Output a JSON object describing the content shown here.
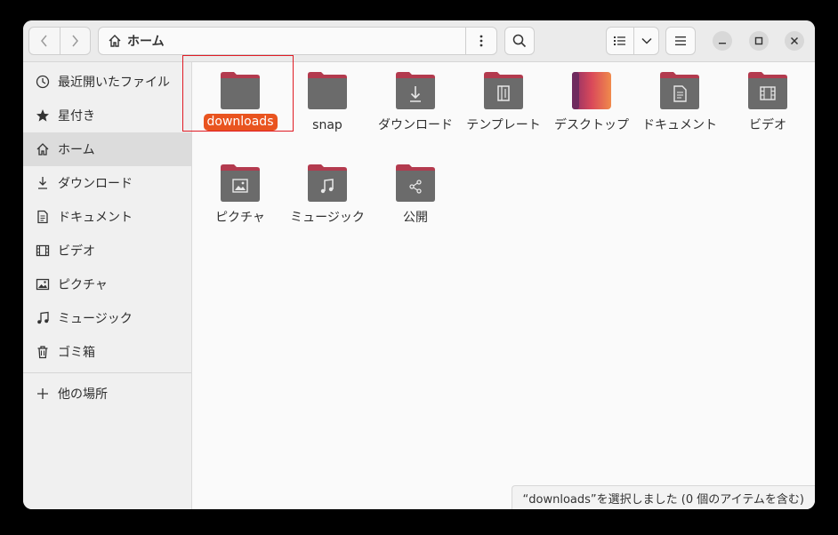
{
  "window": {
    "location_label": "ホーム",
    "status_text": "“downloads”を選択しました (0 個のアイテムを含む)"
  },
  "colors": {
    "accent": "#e9541f",
    "folder_tab": "#b33a4e",
    "folder_body": "#6b6b6b",
    "highlight_box": "#e01b24"
  },
  "sidebar": {
    "items": [
      {
        "label": "最近開いたファイル",
        "icon": "clock-icon"
      },
      {
        "label": "星付き",
        "icon": "star-icon"
      },
      {
        "label": "ホーム",
        "icon": "home-icon",
        "active": true
      },
      {
        "label": "ダウンロード",
        "icon": "download-icon"
      },
      {
        "label": "ドキュメント",
        "icon": "document-icon"
      },
      {
        "label": "ビデオ",
        "icon": "video-icon"
      },
      {
        "label": "ピクチャ",
        "icon": "picture-icon"
      },
      {
        "label": "ミュージック",
        "icon": "music-icon"
      },
      {
        "label": "ゴミ箱",
        "icon": "trash-icon"
      }
    ],
    "other_locations": "他の場所"
  },
  "files": [
    {
      "name": "downloads",
      "icon": "folder-icon",
      "selected": true
    },
    {
      "name": "snap",
      "icon": "folder-icon"
    },
    {
      "name": "ダウンロード",
      "icon": "download-folder-icon"
    },
    {
      "name": "テンプレート",
      "icon": "template-folder-icon"
    },
    {
      "name": "デスクトップ",
      "icon": "desktop-folder-icon"
    },
    {
      "name": "ドキュメント",
      "icon": "document-folder-icon"
    },
    {
      "name": "ビデオ",
      "icon": "video-folder-icon"
    },
    {
      "name": "ピクチャ",
      "icon": "picture-folder-icon"
    },
    {
      "name": "ミュージック",
      "icon": "music-folder-icon"
    },
    {
      "name": "公開",
      "icon": "share-folder-icon"
    }
  ]
}
